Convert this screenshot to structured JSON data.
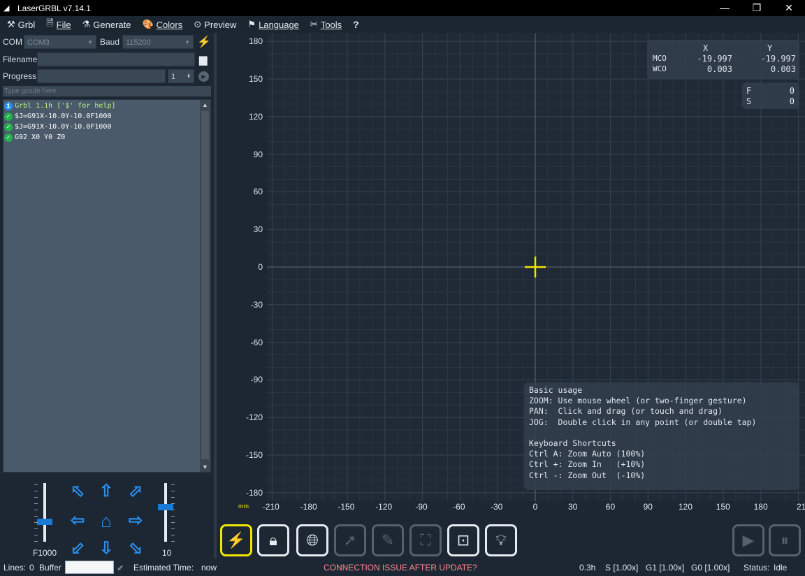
{
  "window": {
    "title": "LaserGRBL v7.14.1",
    "minimize": "—",
    "restore": "❐",
    "close": "✕"
  },
  "menu": [
    {
      "icon": "⚒",
      "label": "Grbl"
    },
    {
      "icon": "🗎",
      "label": "File"
    },
    {
      "icon": "⚗",
      "label": "Generate"
    },
    {
      "icon": "🎨",
      "label": "Colors"
    },
    {
      "icon": "⊙",
      "label": "Preview"
    },
    {
      "icon": "⚑",
      "label": "Language"
    },
    {
      "icon": "✂",
      "label": "Tools"
    },
    {
      "icon": "",
      "label": "?"
    }
  ],
  "connection": {
    "com_label": "COM",
    "com_value": "COM3",
    "baud_label": "Baud",
    "baud_value": "115200"
  },
  "file": {
    "filename_label": "Filename",
    "progress_label": "Progress",
    "copies": "1"
  },
  "gcode_input": {
    "placeholder": "Type gcode here"
  },
  "console": [
    {
      "status": "info",
      "text": "Grbl 1.1h ['$' for help]"
    },
    {
      "status": "ok",
      "text": "$J=G91X-10.0Y-10.0F1000"
    },
    {
      "status": "ok",
      "text": "$J=G91X-10.0Y-10.0F1000"
    },
    {
      "status": "ok",
      "text": "G92 X0 Y0 Z0"
    }
  ],
  "jog": {
    "speed_label": "F1000",
    "step_label": "10",
    "speed_level": 0.35,
    "step_level": 0.6
  },
  "coords": {
    "x_header": "X",
    "y_header": "Y",
    "mco_label": "MCO",
    "wco_label": "WCO",
    "mco_x": "-19.997",
    "mco_y": "-19.997",
    "wco_x": "0.003",
    "wco_y": "0.003",
    "f_label": "F",
    "f_value": "0",
    "s_label": "S",
    "s_value": "0"
  },
  "axis": {
    "unit": "mm",
    "y_ticks": [
      "180",
      "150",
      "120",
      "90",
      "60",
      "30",
      "0",
      "-30",
      "-60",
      "-90",
      "-120",
      "-150",
      "-180"
    ],
    "x_ticks": [
      "-210",
      "-180",
      "-150",
      "-120",
      "-90",
      "-60",
      "-30",
      "0",
      "30",
      "60",
      "90",
      "120",
      "150",
      "180",
      "21"
    ]
  },
  "help": [
    "Basic usage",
    "ZOOM: Use mouse wheel (or two-finger gesture)",
    "PAN:  Click and drag (or touch and drag)",
    "JOG:  Double click in any point (or double tap)",
    "",
    "Keyboard Shortcuts",
    "Ctrl A: Zoom Auto (100%)",
    "Ctrl +: Zoom In   (+10%)",
    "Ctrl -: Zoom Out  (-10%)"
  ],
  "status": {
    "lines_label": "Lines:",
    "lines_value": "0",
    "buffer_label": "Buffer",
    "estimated_label": "Estimated Time:",
    "estimated_value": "now",
    "notice": "CONNECTION ISSUE AFTER UPDATE?",
    "time": "0.3h",
    "s_override": "S [1.00x]",
    "g1_override": "G1 [1.00x]",
    "g0_override": "G0 [1.00x]",
    "status_label": "Status:",
    "status_value": "Idle"
  },
  "colors": {
    "accent_blue": "#2a8ff0",
    "cursor_yellow": "#f2e600",
    "notice_red": "#ff8a8a",
    "ok_green": "#22b14c",
    "info_blue": "#2a8ff0"
  }
}
